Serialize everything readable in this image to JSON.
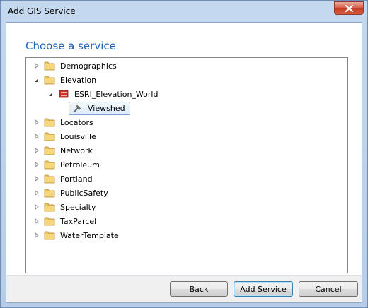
{
  "window": {
    "title": "Add GIS Service"
  },
  "heading": "Choose a service",
  "tree": [
    {
      "label": "Demographics",
      "state": "collapsed",
      "level": 0,
      "icon": "folder-icon"
    },
    {
      "label": "Elevation",
      "state": "expanded",
      "level": 0,
      "icon": "folder-icon"
    },
    {
      "label": "ESRI_Elevation_World",
      "state": "expanded",
      "level": 1,
      "icon": "server-icon"
    },
    {
      "label": "Viewshed",
      "state": "leaf",
      "level": 2,
      "icon": "tool-icon",
      "selected": true
    },
    {
      "label": "Locators",
      "state": "collapsed",
      "level": 0,
      "icon": "folder-icon"
    },
    {
      "label": "Louisville",
      "state": "collapsed",
      "level": 0,
      "icon": "folder-icon"
    },
    {
      "label": "Network",
      "state": "collapsed",
      "level": 0,
      "icon": "folder-icon"
    },
    {
      "label": "Petroleum",
      "state": "collapsed",
      "level": 0,
      "icon": "folder-icon"
    },
    {
      "label": "Portland",
      "state": "collapsed",
      "level": 0,
      "icon": "folder-icon"
    },
    {
      "label": "PublicSafety",
      "state": "collapsed",
      "level": 0,
      "icon": "folder-icon"
    },
    {
      "label": "Specialty",
      "state": "collapsed",
      "level": 0,
      "icon": "folder-icon"
    },
    {
      "label": "TaxParcel",
      "state": "collapsed",
      "level": 0,
      "icon": "folder-icon"
    },
    {
      "label": "WaterTemplate",
      "state": "collapsed",
      "level": 0,
      "icon": "folder-icon"
    }
  ],
  "buttons": {
    "back": "Back",
    "add_service": "Add Service",
    "cancel": "Cancel"
  },
  "colors": {
    "heading": "#1e64b4",
    "selection_border": "#7da2ce",
    "folder": "#e8c25a"
  }
}
